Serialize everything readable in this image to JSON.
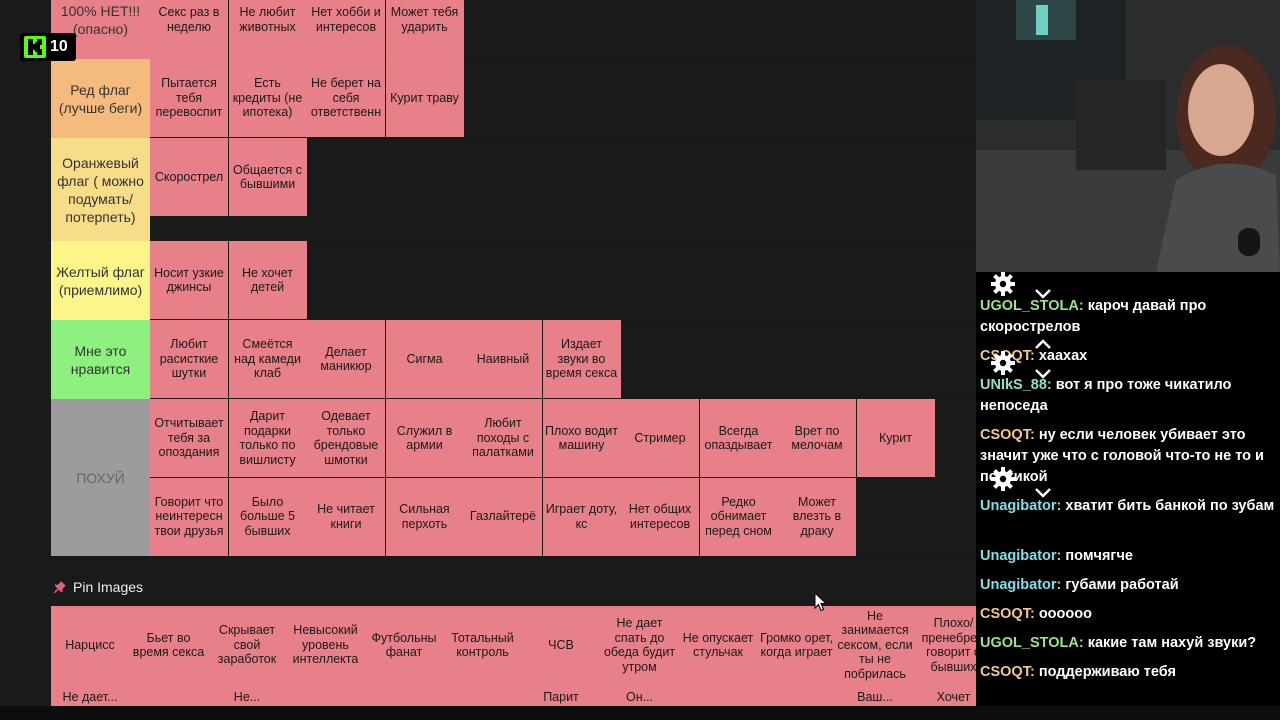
{
  "stream": {
    "kick_viewers": "10"
  },
  "tier_rows": [
    {
      "label": "100% НЕТ!!!\n(опасно)",
      "color": "#e8808a",
      "items": [
        "Секс раз в неделю",
        "Не любит животных",
        "Нет хобби и интересов",
        "Может тебя ударить"
      ]
    },
    {
      "label": "Ред флаг\n(лучше беги)",
      "color": "#f5bb7e",
      "items": [
        "Пытается тебя перевоспит",
        "Есть кредиты (не ипотека)",
        "Не берет на себя ответственн",
        "Курит траву"
      ]
    },
    {
      "label": "Оранжевый флаг ( можно подумать/ потерпеть)",
      "color": "#f7dd88",
      "items": [
        "Скорострел",
        "Общается с бывшими"
      ]
    },
    {
      "label": "Желтый флаг (приемлимо)",
      "color": "#fbf58a",
      "items": [
        "Носит узкие джинсы",
        "Не хочет детей"
      ]
    },
    {
      "label": "Мне это нравится",
      "color": "#8ef07f",
      "items": [
        "Любит расисткие шутки",
        "Смеётся над камеди клаб",
        "Делает маникюр",
        "Сигма",
        "Наивный",
        "Издает звуки во время секса"
      ]
    },
    {
      "label": "ПОХУЙ",
      "color": "#9c9c9c",
      "items": [
        "Отчитывает тебя за опоздания",
        "Дарит подарки только по вишлисту",
        "Одевает только брендовые шмотки",
        "Служил в армии",
        "Любит походы с палатками",
        "Плохо водит машину",
        "Стример",
        "Всегда опаздывает",
        "Врет по мелочам",
        "Курит",
        "Говорит что неинтересн твои друзья",
        "Было больше 5 бывших",
        "Не читает книги",
        "Сильная перхоть",
        "Газлайтерё",
        "Играет доту, кс",
        "Нет общих интересов",
        "Редко обнимает перед сном",
        "Может влезть в драку"
      ]
    }
  ],
  "pin": {
    "title": "Pin Images",
    "items": [
      "Нарцисс",
      "Бьет во время секса",
      "Скрывает свой заработок",
      "Невысокий уровень интеллекта",
      "Футбольны фанат",
      "Тотальный контроль",
      "ЧСВ",
      "Не дает спать до обеда будит утром",
      "Не опускает стульчак",
      "Громко орет, когда играет",
      "Не занимается сексом, если ты не побрилась",
      "Плохо/ пренебреж говорит о бывших"
    ],
    "items_row2": [
      "Не дает...",
      "",
      "Не...",
      "",
      "",
      "",
      "Парит",
      "Он...",
      "",
      "",
      "Ваш...",
      "Хочет"
    ]
  },
  "chat": [
    {
      "user": "UGOL_STOLA",
      "user_color": "#9be48a",
      "text": "кароч давай про скорострелов"
    },
    {
      "user": "CSOQT",
      "user_color": "#f3c98b",
      "text": "хаахах"
    },
    {
      "user": "UNIkS_88",
      "user_color": "#8fe1c9",
      "text": "вот я про тоже чикатило непоседа"
    },
    {
      "user": "CSOQT",
      "user_color": "#f3c98b",
      "text": "ну если человек убивает это значит уже что с головой что-то не то и психикой"
    },
    {
      "user": "Unagibator",
      "user_color": "#7fe0e8",
      "text": "хватит бить банкой по зубам"
    },
    {
      "user": "Unagibator",
      "user_color": "#7fe0e8",
      "text": "помчягче"
    },
    {
      "user": "Unagibator",
      "user_color": "#7fe0e8",
      "text": "губами работай"
    },
    {
      "user": "CSOQT",
      "user_color": "#f3c98b",
      "text": "оооооо"
    },
    {
      "user": "UGOL_STOLA",
      "user_color": "#9be48a",
      "text": "какие там нахуй звуки?"
    },
    {
      "user": "CSOQT",
      "user_color": "#f3c98b",
      "text": "поддерживаю тебя"
    }
  ]
}
